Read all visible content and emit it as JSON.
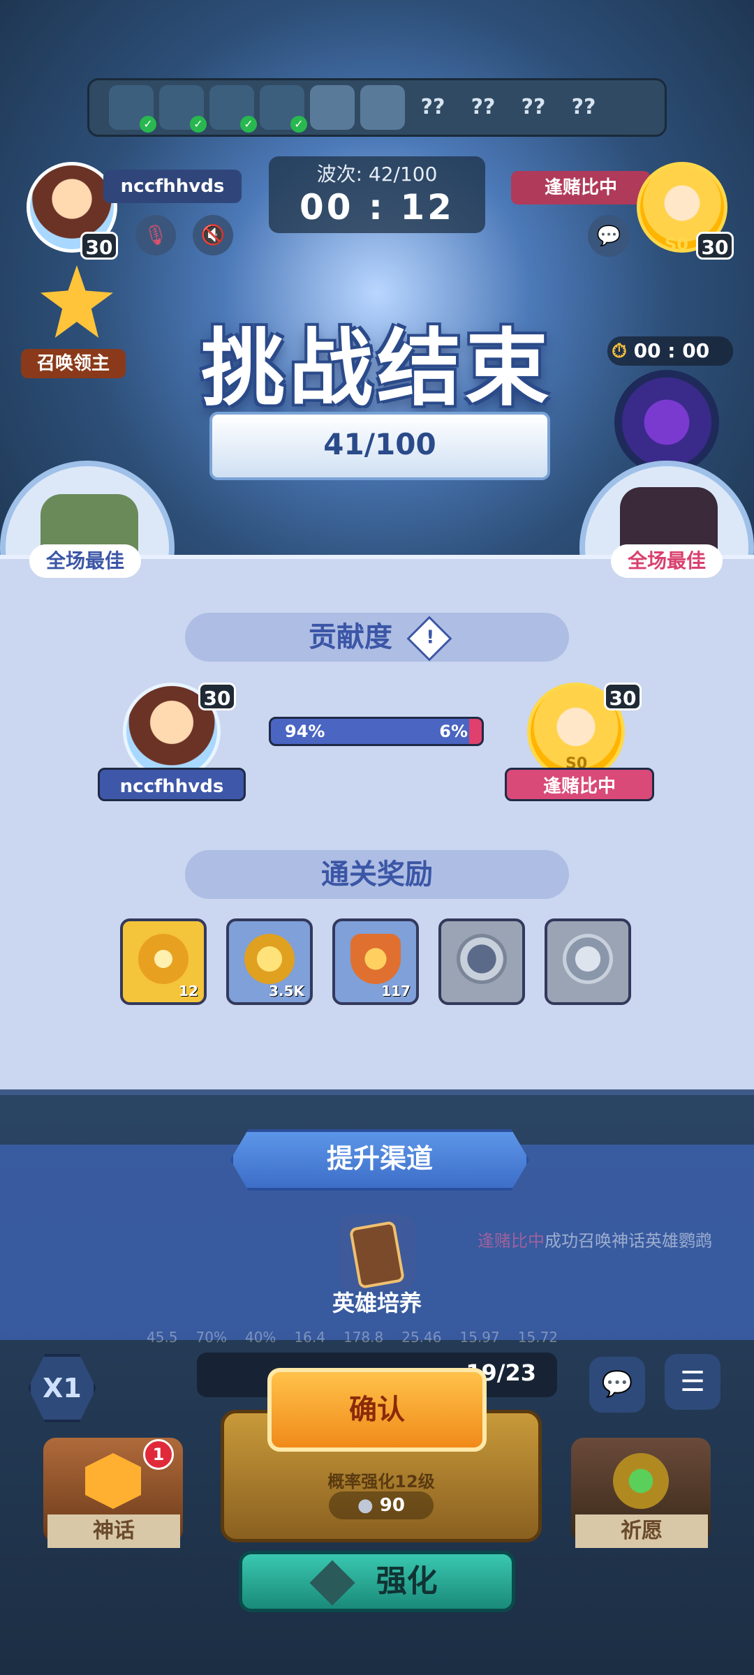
{
  "top": {
    "heroes": [
      {
        "state": "done"
      },
      {
        "state": "done"
      },
      {
        "state": "done"
      },
      {
        "state": "done"
      },
      {
        "state": "current"
      },
      {
        "state": "current"
      },
      {
        "state": "unknown",
        "glyph": "??"
      },
      {
        "state": "unknown",
        "glyph": "??"
      },
      {
        "state": "unknown",
        "glyph": "??"
      },
      {
        "state": "unknown",
        "glyph": "??"
      }
    ],
    "player_left": {
      "name": "nccfhhvds",
      "level": "30"
    },
    "player_right": {
      "name": "逢赌比中",
      "level": "30",
      "badge": "S0"
    },
    "wave_label": "波次: 42/100",
    "timer": "00 : 12",
    "summon_lord": "召唤领主",
    "side_timer": "00 : 00"
  },
  "result": {
    "title": "挑战结束",
    "score": "41/100",
    "mvp_left": "全场最佳",
    "mvp_right": "全场最佳"
  },
  "contribution": {
    "header": "贡献度",
    "left": {
      "name": "nccfhhvds",
      "level": "30",
      "percent_label": "94%",
      "share": 0.94
    },
    "right": {
      "name": "逢赌比中",
      "level": "30",
      "percent_label": "6%",
      "share": 0.06,
      "badge": "S0"
    }
  },
  "rewards": {
    "header": "通关奖励",
    "items": [
      {
        "icon": "key-icon",
        "count": "12",
        "style": "gold"
      },
      {
        "icon": "coin-icon",
        "count": "3.5K",
        "style": "blue"
      },
      {
        "icon": "trophy-icon",
        "count": "117",
        "style": "blue"
      },
      {
        "icon": "shield-icon",
        "count": "",
        "style": "gray"
      },
      {
        "icon": "emblem-icon",
        "count": "",
        "style": "gray"
      }
    ]
  },
  "upgrade": {
    "header": "提升渠道",
    "item_label": "英雄培养",
    "feed_name": "逢赌比中",
    "feed_text": "成功召唤神话英雄鹦鹉",
    "stats": [
      "45.5",
      "70%",
      "40%",
      "16.4",
      "178.8",
      "25.46",
      "15.97",
      "15.72"
    ]
  },
  "bottom": {
    "speed": "X1",
    "counter": "19/23",
    "confirm": "确认",
    "myth_label": "神话",
    "myth_badge": "1",
    "wish_label": "祈愿",
    "prob_text": "概率强化12级",
    "cost": "90",
    "enhance": "强化"
  },
  "colors": {
    "accent_blue": "#4a65c2",
    "accent_pink": "#e0406e",
    "panel": "#cbd6f0"
  }
}
